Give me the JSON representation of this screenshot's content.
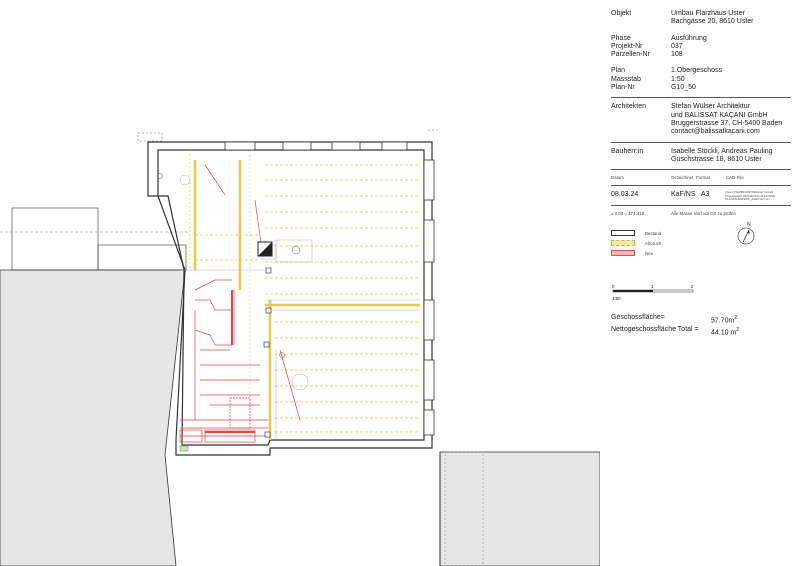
{
  "title_block": {
    "objekt_label": "Objekt",
    "objekt_value_1": "Umbau Flarzhaus Uster",
    "objekt_value_2": "Bachgasse 20, 8610 Uster",
    "phase_label": "Phase",
    "phase_value": "Ausführung",
    "projekt_label": "Projekt-Nr",
    "projekt_value": "037",
    "parzellen_label": "Parzellen-Nr",
    "parzellen_value": "108",
    "plan_label": "Plan",
    "plan_value": "1.Obergeschoss",
    "massstab_label": "Massstab",
    "massstab_value": "1:50",
    "plan_nr_label": "Plan-Nr",
    "plan_nr_value": "G10_50",
    "architekten_label": "Architekten",
    "architekten_1": "Stefan Wülser Architektur",
    "architekten_2": "und BALISSAT KAÇANI GmbH",
    "architekten_3": "Bruggerstrasse 37, CH-5400 Baden",
    "architekten_4": "contact@balissatkacani.com",
    "bauherr_label": "Bauherr:in",
    "bauherr_1": "Isabelle Stöckli, Andreas Pauling",
    "bauherr_2": "Guschstrasse 18, 8610 Uster",
    "datum_header": "Datum",
    "gezeichnet_header": "Gezeichnet",
    "format_header": "Format",
    "cad_header": "CAD-File",
    "datum_value": "08.03.24",
    "gezeichnet_value": "KaF/NS",
    "format_value": "A3",
    "cad_line_1": "Cloud-Pfad/BKA037/Balissat Kacani",
    "cad_line_2": "Projekte/037-PROJEKTPLANUNG/00",
    "cad_line_3": "PLANFAHRWERK_data/Flarz.pln",
    "hoehe_note": "± 0.00 = 474.416",
    "masse_note": "Alle Masse sind vor Ort zu prüfen"
  },
  "legend": {
    "bestand": "Bestand",
    "abbruch": "Abbruch",
    "neu": "Neu"
  },
  "scale_bar": {
    "tick_0": "0",
    "tick_1": "1",
    "tick_2": "2",
    "ratio": "1:50"
  },
  "areas": {
    "geschoss_label": "Geschossfläche=",
    "geschoss_value": "57.70m",
    "netto_label": "Nettogeschossfläche Total =",
    "netto_value": "44.10 m",
    "unit_sup": "2"
  },
  "colors": {
    "existing": "#333333",
    "demolition": "#e8c94a",
    "new": "#e0454d",
    "neighbor_fill": "#e6e6e6"
  }
}
